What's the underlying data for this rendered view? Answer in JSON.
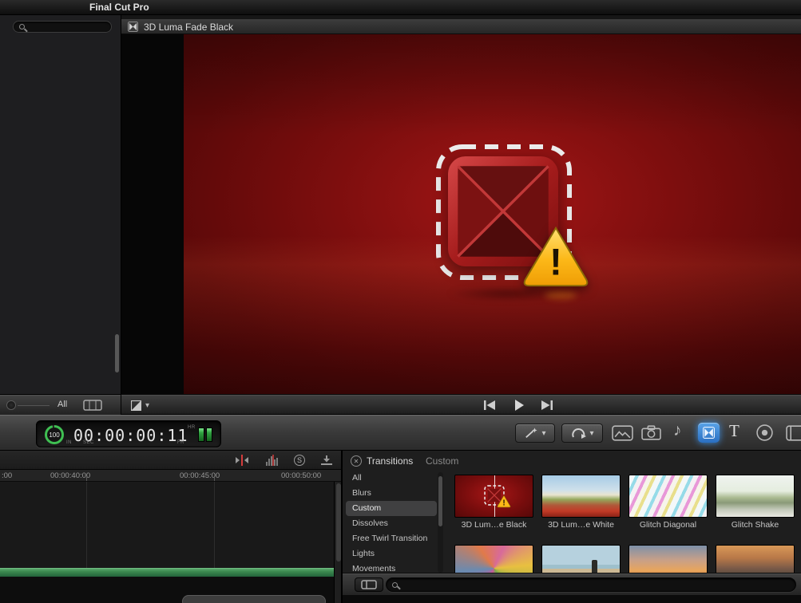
{
  "menu_bar": {
    "app_name": "Final Cut Pro"
  },
  "sidebar": {
    "filter_label": "All"
  },
  "viewer": {
    "title": "3D Luma Fade Black",
    "warning_mark": "!"
  },
  "dashboard": {
    "gauge_value": "100",
    "timecode": "00:00:00:11",
    "in_label": "IN",
    "sec_label": "SEC",
    "fr_label": "FR",
    "hr_label": "HR"
  },
  "toolbar": {
    "titles_label": "T"
  },
  "timeline": {
    "ruler_ticks": [
      ":00",
      "00:00:40:00",
      "00:00:45:00",
      "00:00:50:00"
    ],
    "solo_label": "S"
  },
  "transitions": {
    "title": "Transitions",
    "subtitle": "Custom",
    "selected_category": "Custom",
    "categories": [
      "All",
      "Blurs",
      "Custom",
      "Dissolves",
      "Free Twirl Transition",
      "Lights",
      "Movements"
    ],
    "items": [
      {
        "name": "3D Lum…e Black"
      },
      {
        "name": "3D Lum…e White"
      },
      {
        "name": "Glitch Diagonal"
      },
      {
        "name": "Glitch Shake"
      }
    ]
  },
  "icons": {
    "chevron_down": "▾",
    "music_note": "♪",
    "close_x": "✕"
  },
  "colors": {
    "accent_blue": "#3b8fd9",
    "warning_yellow": "#f7b500",
    "viewer_red": "#8f1010",
    "clip_green": "#3f8a52"
  }
}
